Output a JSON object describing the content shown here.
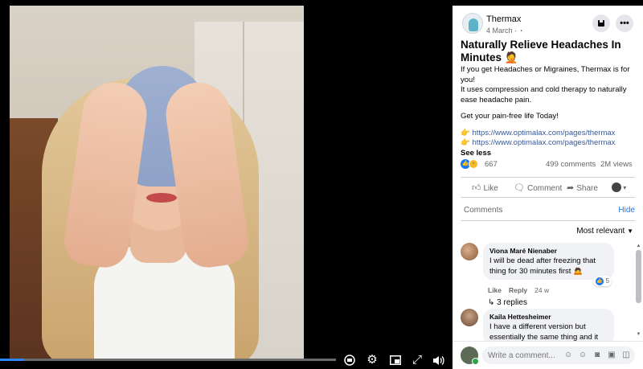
{
  "video": {
    "progress_percent": 7,
    "controls": {
      "captions_icon": "captions-icon",
      "settings_icon": "gear-icon",
      "pip_icon": "picture-in-picture-icon",
      "fullscreen_icon": "fullscreen-icon",
      "volume_icon": "volume-icon"
    }
  },
  "post": {
    "page_name": "Thermax",
    "date": "4 March · ",
    "privacy_icon": "globe-icon",
    "title": "Naturally Relieve Headaches In Minutes 🤦",
    "body_lines": [
      "If you get Headaches or Migraines, Thermax is for you!",
      "It uses compression and cold therapy to naturally ease headache pain.",
      "Get your pain-free life Today!"
    ],
    "links": [
      "👉 https://www.optimalax.com/pages/thermax",
      "👉 https://www.optimalax.com/pages/thermax"
    ],
    "see_less": "See less",
    "reactions_count": "667",
    "comments_count": "499 comments",
    "views_count": "2M views"
  },
  "actions": {
    "like": "Like",
    "comment": "Comment",
    "share": "Share"
  },
  "comments_section": {
    "label": "Comments",
    "hide": "Hide",
    "sort": "Most relevant"
  },
  "comments": [
    {
      "author": "Viona Maré Nienaber",
      "text_line1": "I will be dead after freezing that",
      "text_line2": "thing for 30 minutes first 🙇",
      "like": "Like",
      "reply": "Reply",
      "age": "24 w",
      "likes": "5",
      "replies": "3 replies"
    },
    {
      "author": "Kaila Hettesheimer",
      "text_line1": "I have a different version but",
      "text_line2": "essentially the same thing and it"
    }
  ],
  "composer": {
    "placeholder": "Write a comment..."
  },
  "colors": {
    "accent": "#1877f2",
    "link": "#385898",
    "progress": "#2d88ff"
  }
}
